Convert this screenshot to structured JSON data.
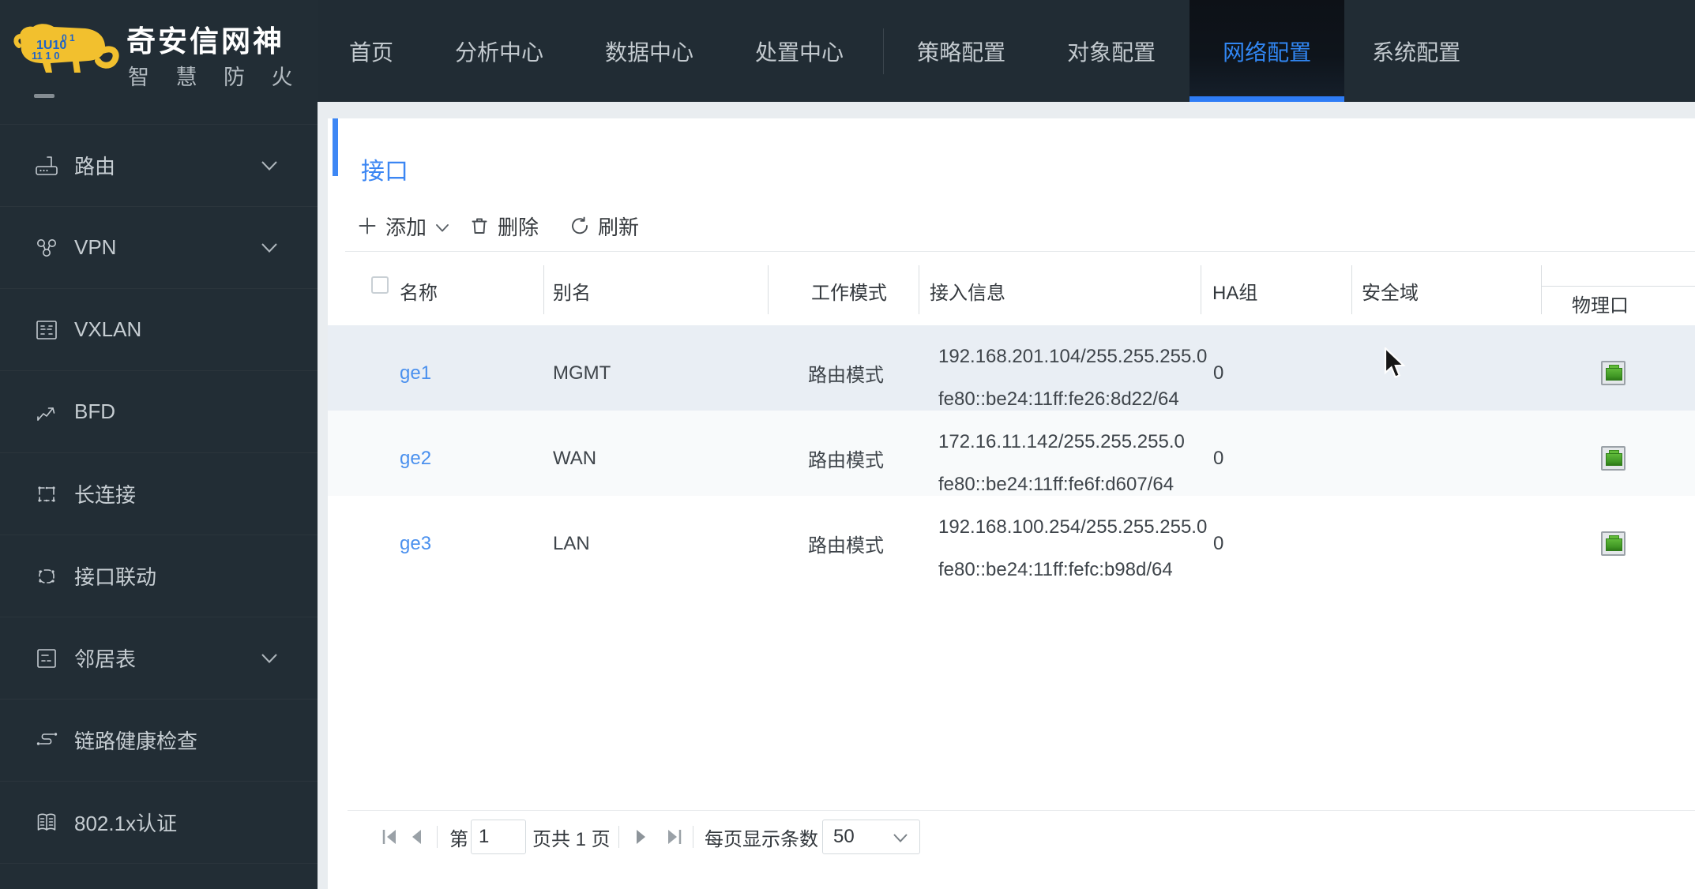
{
  "brand": {
    "title": "奇安信网神",
    "subtitle": "智 慧 防 火 墙",
    "logo_icon": "tiger-logo-icon"
  },
  "nav": {
    "tabs": [
      {
        "label": "首页"
      },
      {
        "label": "分析中心"
      },
      {
        "label": "数据中心"
      },
      {
        "label": "处置中心",
        "divider_after": true
      },
      {
        "label": "策略配置"
      },
      {
        "label": "对象配置"
      },
      {
        "label": "网络配置",
        "active": true
      },
      {
        "label": "系统配置"
      }
    ]
  },
  "sidebar": {
    "items": [
      {
        "label": "路由",
        "icon": "router-icon",
        "expandable": true
      },
      {
        "label": "VPN",
        "icon": "vpn-icon",
        "expandable": true
      },
      {
        "label": "VXLAN",
        "icon": "vxlan-server-icon",
        "expandable": false
      },
      {
        "label": "BFD",
        "icon": "bfd-arrow-icon",
        "expandable": false
      },
      {
        "label": "长连接",
        "icon": "long-connection-icon",
        "expandable": false
      },
      {
        "label": "接口联动",
        "icon": "interface-linkage-icon",
        "expandable": false
      },
      {
        "label": "邻居表",
        "icon": "neighbor-table-icon",
        "expandable": true
      },
      {
        "label": "链路健康检查",
        "icon": "link-health-icon",
        "expandable": false
      },
      {
        "label": "802.1x认证",
        "icon": "book-auth-icon",
        "expandable": false
      }
    ]
  },
  "page": {
    "title": "接口",
    "toolbar": {
      "add_label": "添加",
      "delete_label": "删除",
      "refresh_label": "刷新"
    },
    "table": {
      "columns": {
        "name": "名称",
        "alias": "别名",
        "mode": "工作模式",
        "info": "接入信息",
        "ha": "HA组",
        "zone": "安全域",
        "port": "物理口"
      },
      "rows": [
        {
          "name": "ge1",
          "alias": "MGMT",
          "mode": "路由模式",
          "ip4": "192.168.201.104/255.255.255.0",
          "ip6": "fe80::be24:11ff:fe26:8d22/64",
          "ha": "0",
          "zone": "",
          "port_status": "connected"
        },
        {
          "name": "ge2",
          "alias": "WAN",
          "mode": "路由模式",
          "ip4": "172.16.11.142/255.255.255.0",
          "ip6": "fe80::be24:11ff:fe6f:d607/64",
          "ha": "0",
          "zone": "",
          "port_status": "connected"
        },
        {
          "name": "ge3",
          "alias": "LAN",
          "mode": "路由模式",
          "ip4": "192.168.100.254/255.255.255.0",
          "ip6": "fe80::be24:11ff:fefc:b98d/64",
          "ha": "0",
          "zone": "",
          "port_status": "connected"
        }
      ]
    },
    "pagination": {
      "page_prefix": "第",
      "page_value": "1",
      "page_suffix": "页共 1 页",
      "per_page_label": "每页显示条数",
      "per_page_value": "50"
    }
  },
  "colors": {
    "accent_blue": "#2e7cf6",
    "link_blue": "#4a90ee",
    "port_green": "#3f9624",
    "dark_bg": "#222d35"
  }
}
